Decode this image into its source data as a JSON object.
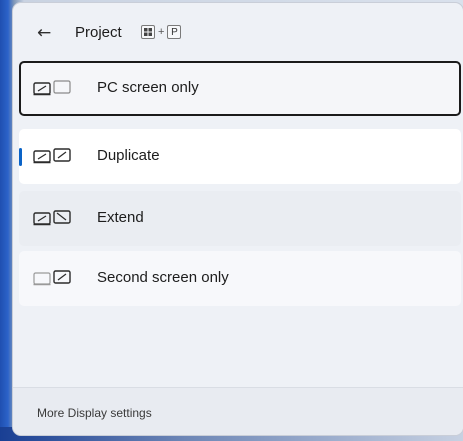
{
  "header": {
    "back_icon": "back-arrow-icon",
    "title": "Project",
    "shortcut": {
      "key1_icon": "windows-key-icon",
      "plus": "+",
      "key2": "P"
    }
  },
  "options": [
    {
      "label": "PC screen only",
      "icon": "pc-screen-only-icon",
      "focused": true,
      "selected": false
    },
    {
      "label": "Duplicate",
      "icon": "duplicate-icon",
      "focused": false,
      "selected": true
    },
    {
      "label": "Extend",
      "icon": "extend-icon",
      "focused": false,
      "selected": false
    },
    {
      "label": "Second screen only",
      "icon": "second-screen-only-icon",
      "focused": false,
      "selected": false
    }
  ],
  "footer": {
    "link": "More Display settings"
  },
  "colors": {
    "accent": "#0a63c7",
    "focus_border": "#1b1b1b",
    "panel_bg": "#eef1f6"
  }
}
